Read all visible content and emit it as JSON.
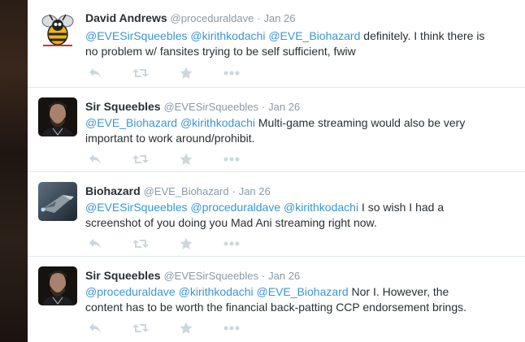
{
  "tweets": [
    {
      "name": "David Andrews",
      "handle": "@proceduraldave",
      "sep": "·",
      "time": "Jan 26",
      "mentions": [
        "@EVESirSqueebles",
        "@kirithkodachi",
        "@EVE_Biohazard"
      ],
      "text_line1": "definitely. I think there is",
      "text_line2": "no problem w/ fansites trying to be self sufficient, fwiw",
      "avatar": "bee-avatar-icon"
    },
    {
      "name": "Sir Squeebles",
      "handle": "@EVESirSqueebles",
      "sep": "·",
      "time": "Jan 26",
      "mentions": [
        "@EVE_Biohazard",
        "@kirithkodachi"
      ],
      "text_line1": "Multi-game streaming would also be very",
      "text_line2": "important to work around/prohibit.",
      "avatar": "bearded-man-avatar-icon"
    },
    {
      "name": "Biohazard",
      "handle": "@EVE_Biohazard",
      "sep": "·",
      "time": "Jan 26",
      "mentions": [
        "@EVESirSqueebles",
        "@proceduraldave",
        "@kirithkodachi"
      ],
      "text_line1": "I so wish I had a",
      "text_line2": "screenshot of you doing you Mad Ani streaming right now.",
      "avatar": "spaceship-avatar-icon"
    },
    {
      "name": "Sir Squeebles",
      "handle": "@EVESirSqueebles",
      "sep": "·",
      "time": "Jan 26",
      "mentions": [
        "@proceduraldave",
        "@kirithkodachi",
        "@EVE_Biohazard"
      ],
      "text_line1": "Nor I. However, the",
      "text_line2": "content has to be worth the financial back-patting CCP endorsement brings.",
      "avatar": "bearded-man-avatar-icon"
    }
  ],
  "icons": {
    "reply": "reply-icon",
    "retweet": "retweet-icon",
    "favorite": "star-icon",
    "more": "more-dots-icon"
  },
  "colors": {
    "link": "#3b94d9",
    "name": "#292f33",
    "meta": "#8899a6",
    "action": "#ccd6dd"
  }
}
